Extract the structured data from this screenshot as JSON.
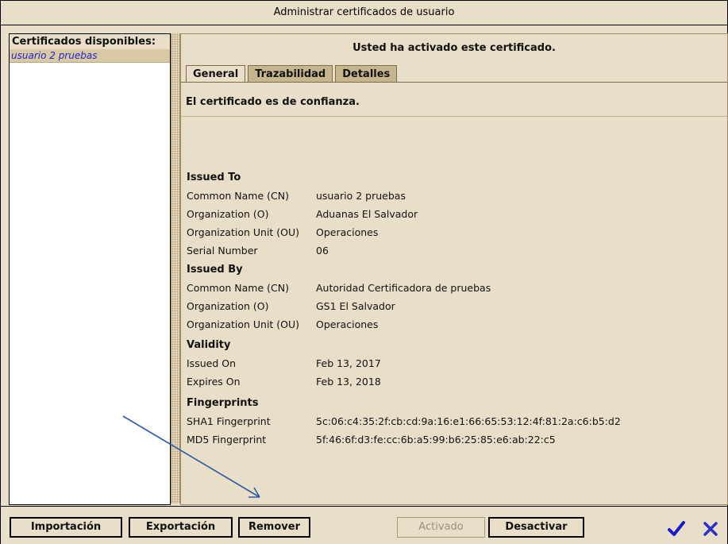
{
  "window": {
    "title": "Administrar certificados de usuario"
  },
  "left": {
    "title": "Certificados disponibles:",
    "items": [
      {
        "label": "usuario 2 pruebas"
      }
    ]
  },
  "right": {
    "status": "Usted ha activado este certificado.",
    "tabs": [
      {
        "label": "General"
      },
      {
        "label": "Trazabilidad"
      },
      {
        "label": "Detalles"
      }
    ],
    "trust": "El certificado es de confianza.",
    "issued_to": {
      "heading": "Issued To",
      "rows": [
        {
          "k": "Common Name (CN)",
          "v": "usuario 2 pruebas"
        },
        {
          "k": "Organization (O)",
          "v": "Aduanas El Salvador"
        },
        {
          "k": "Organization Unit (OU)",
          "v": "Operaciones"
        },
        {
          "k": "Serial Number",
          "v": "06"
        }
      ]
    },
    "issued_by": {
      "heading": "Issued By",
      "rows": [
        {
          "k": "Common Name (CN)",
          "v": "Autoridad Certificadora de pruebas"
        },
        {
          "k": "Organization (O)",
          "v": "GS1 El Salvador"
        },
        {
          "k": "Organization Unit (OU)",
          "v": "Operaciones"
        }
      ]
    },
    "validity": {
      "heading": "Validity",
      "rows": [
        {
          "k": "Issued On",
          "v": "Feb 13, 2017"
        },
        {
          "k": "Expires On",
          "v": "Feb 13, 2018"
        }
      ]
    },
    "fingerprints": {
      "heading": "Fingerprints",
      "rows": [
        {
          "k": "SHA1 Fingerprint",
          "v": "5c:06:c4:35:2f:cb:cd:9a:16:e1:66:65:53:12:4f:81:2a:c6:b5:d2"
        },
        {
          "k": "MD5 Fingerprint",
          "v": "5f:46:6f:d3:fe:cc:6b:a5:99:b6:25:85:e6:ab:22:c5"
        }
      ]
    }
  },
  "buttons": {
    "import": "Importación",
    "export": "Exportación",
    "remove": "Remover",
    "activated": "Activado",
    "deactivate": "Desactivar"
  },
  "colors": {
    "accent": "#1f1fd0",
    "panel": "#e9dfc8",
    "selection": "#d8c9a3",
    "arrow": "#2e5aa8"
  },
  "icons": {
    "confirm": "checkmark-icon",
    "cancel": "x-icon"
  }
}
